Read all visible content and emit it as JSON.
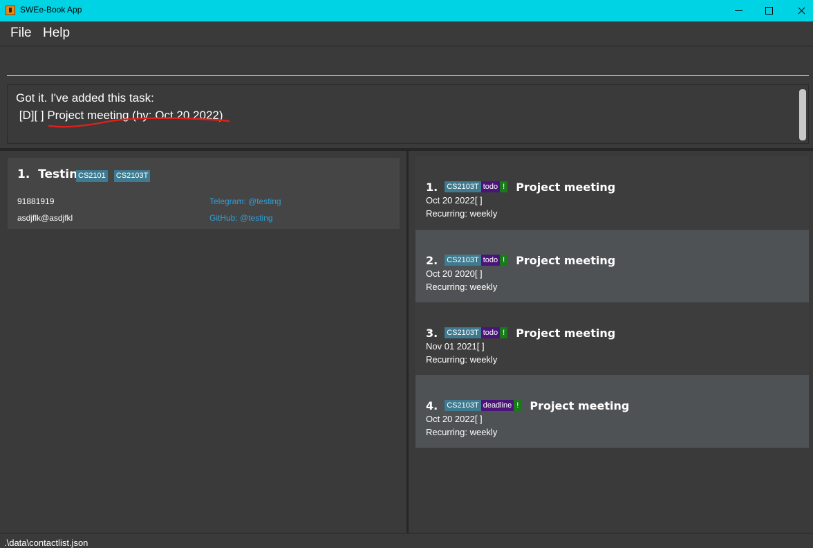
{
  "window": {
    "title": "SWEe-Book App",
    "icon": "app-icon",
    "controls": [
      "minimize-icon",
      "maximize-icon",
      "close-icon"
    ]
  },
  "menu": {
    "file": "File",
    "help": "Help"
  },
  "command": {
    "value": "",
    "placeholder": ""
  },
  "result": {
    "line1": "Got it. I've added this task:",
    "line2": " [D][ ] Project meeting (by: Oct 20 2022)"
  },
  "contacts": [
    {
      "index": "1.",
      "name": "Testing",
      "tags": [
        "CS2101",
        "CS2103T"
      ],
      "phone": "91881919",
      "email": "asdjflk@asdjfkl",
      "telegram": "Telegram: @testing",
      "github": "GitHub: @testing"
    }
  ],
  "tasks": [
    {
      "index": "1.",
      "module": "CS2103T",
      "type": "todo",
      "priority": "!",
      "name": "Project meeting",
      "date": "Oct 20 2022[ ]",
      "recurring": "Recurring: weekly"
    },
    {
      "index": "2.",
      "module": "CS2103T",
      "type": "todo",
      "priority": "!",
      "name": "Project meeting",
      "date": "Oct 20 2020[ ]",
      "recurring": "Recurring: weekly"
    },
    {
      "index": "3.",
      "module": "CS2103T",
      "type": "todo",
      "priority": "!",
      "name": "Project meeting",
      "date": "Nov 01 2021[ ]",
      "recurring": "Recurring: weekly"
    },
    {
      "index": "4.",
      "module": "CS2103T",
      "type": "deadline",
      "priority": "!",
      "name": "Project meeting",
      "date": "Oct 20 2022[ ]",
      "recurring": "Recurring: weekly"
    }
  ],
  "status": {
    "path": ".\\data\\contactlist.json"
  },
  "colors": {
    "titlebar": "#00d4e4",
    "background": "#3a3a3a",
    "module_tag": "#3e7b91",
    "type_tag": "#4b1479",
    "priority_tag": "#197a19",
    "link": "#2f9fd8",
    "annotation": "#e0201b"
  }
}
